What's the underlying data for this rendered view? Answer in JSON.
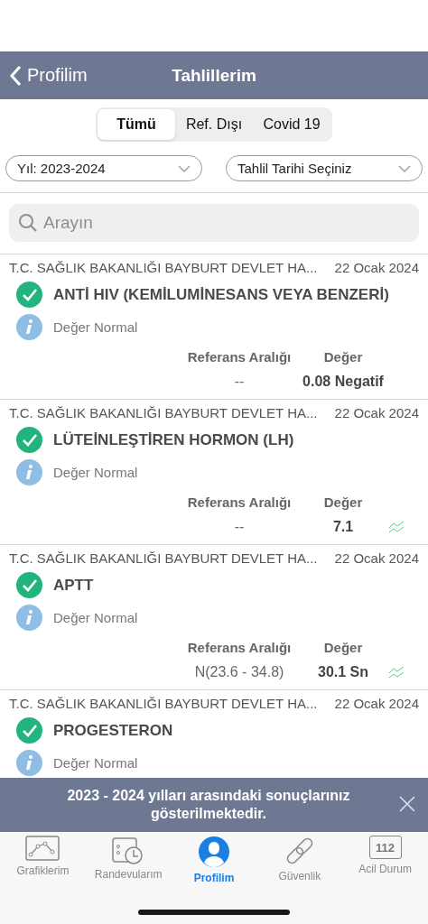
{
  "nav": {
    "back": "Profilim",
    "title": "Tahlillerim"
  },
  "segments": [
    {
      "label": "Tümü",
      "selected": true
    },
    {
      "label": "Ref. Dışı",
      "selected": false
    },
    {
      "label": "Covid 19",
      "selected": false
    }
  ],
  "filters": [
    {
      "value": "Yıl: 2023-2024"
    },
    {
      "value": "Tahlil Tarihi Seçiniz"
    }
  ],
  "search": {
    "placeholder": "Arayın"
  },
  "results": [
    {
      "hospital": "T.C. SAĞLIK BAKANLIĞI BAYBURT DEVLET HA...",
      "date": "22 Ocak 2024",
      "test": "ANTİ HIV (KEMİLUMİNESANS VEYA BENZERİ)",
      "status": "Değer Normal",
      "ref_label": "Referans Aralığı",
      "value_label": "Değer",
      "ref": "--",
      "value": "0.08  Negatif",
      "trend": false
    },
    {
      "hospital": "T.C. SAĞLIK BAKANLIĞI BAYBURT DEVLET HA...",
      "date": "22 Ocak 2024",
      "test": "LÜTEİNLEŞTİREN HORMON (LH)",
      "status": "Değer Normal",
      "ref_label": "Referans Aralığı",
      "value_label": "Değer",
      "ref": "--",
      "value": "7.1",
      "trend": true
    },
    {
      "hospital": "T.C. SAĞLIK BAKANLIĞI BAYBURT DEVLET HA...",
      "date": "22 Ocak 2024",
      "test": "APTT",
      "status": "Değer Normal",
      "ref_label": "Referans Aralığı",
      "value_label": "Değer",
      "ref": "N(23.6 - 34.8)",
      "value": "30.1 Sn",
      "trend": true
    },
    {
      "hospital": "T.C. SAĞLIK BAKANLIĞI BAYBURT DEVLET HA...",
      "date": "22 Ocak 2024",
      "test": "PROGESTERON",
      "status": "Değer Normal"
    }
  ],
  "toast": {
    "message": "2023 - 2024 yılları arasındaki sonuçlarınız gösterilmektedir."
  },
  "tabbar": [
    {
      "kind": "chart",
      "label": "Grafiklerim",
      "selected": false
    },
    {
      "kind": "calendar",
      "label": "Randevularım",
      "selected": false
    },
    {
      "kind": "profile",
      "label": "Profilim",
      "selected": true
    },
    {
      "kind": "link",
      "label": "Güvenlik",
      "selected": false
    },
    {
      "kind": "emergency",
      "label": "Acil Durum",
      "badge": "112",
      "selected": false
    }
  ]
}
